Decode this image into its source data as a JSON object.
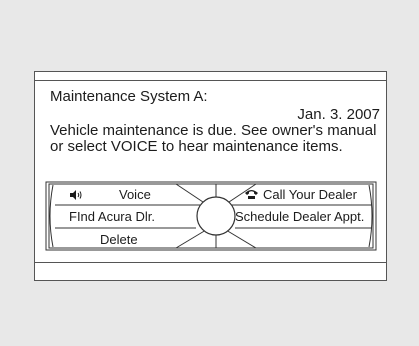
{
  "screen": {
    "title": "Maintenance System A:",
    "date": "Jan. 3. 2007",
    "message": "Vehicle maintenance is due. See owner's manual or select VOICE to hear maintenance items."
  },
  "menu": {
    "voice_label": "Voice",
    "find_dealer_label": "FInd Acura Dlr.",
    "delete_label": "Delete",
    "call_dealer_label": "Call Your Dealer",
    "schedule_label": "Schedule Dealer Appt."
  },
  "icons": {
    "voice": "speaker-icon",
    "call": "phone-icon",
    "knob": "interface-dial-icon"
  }
}
